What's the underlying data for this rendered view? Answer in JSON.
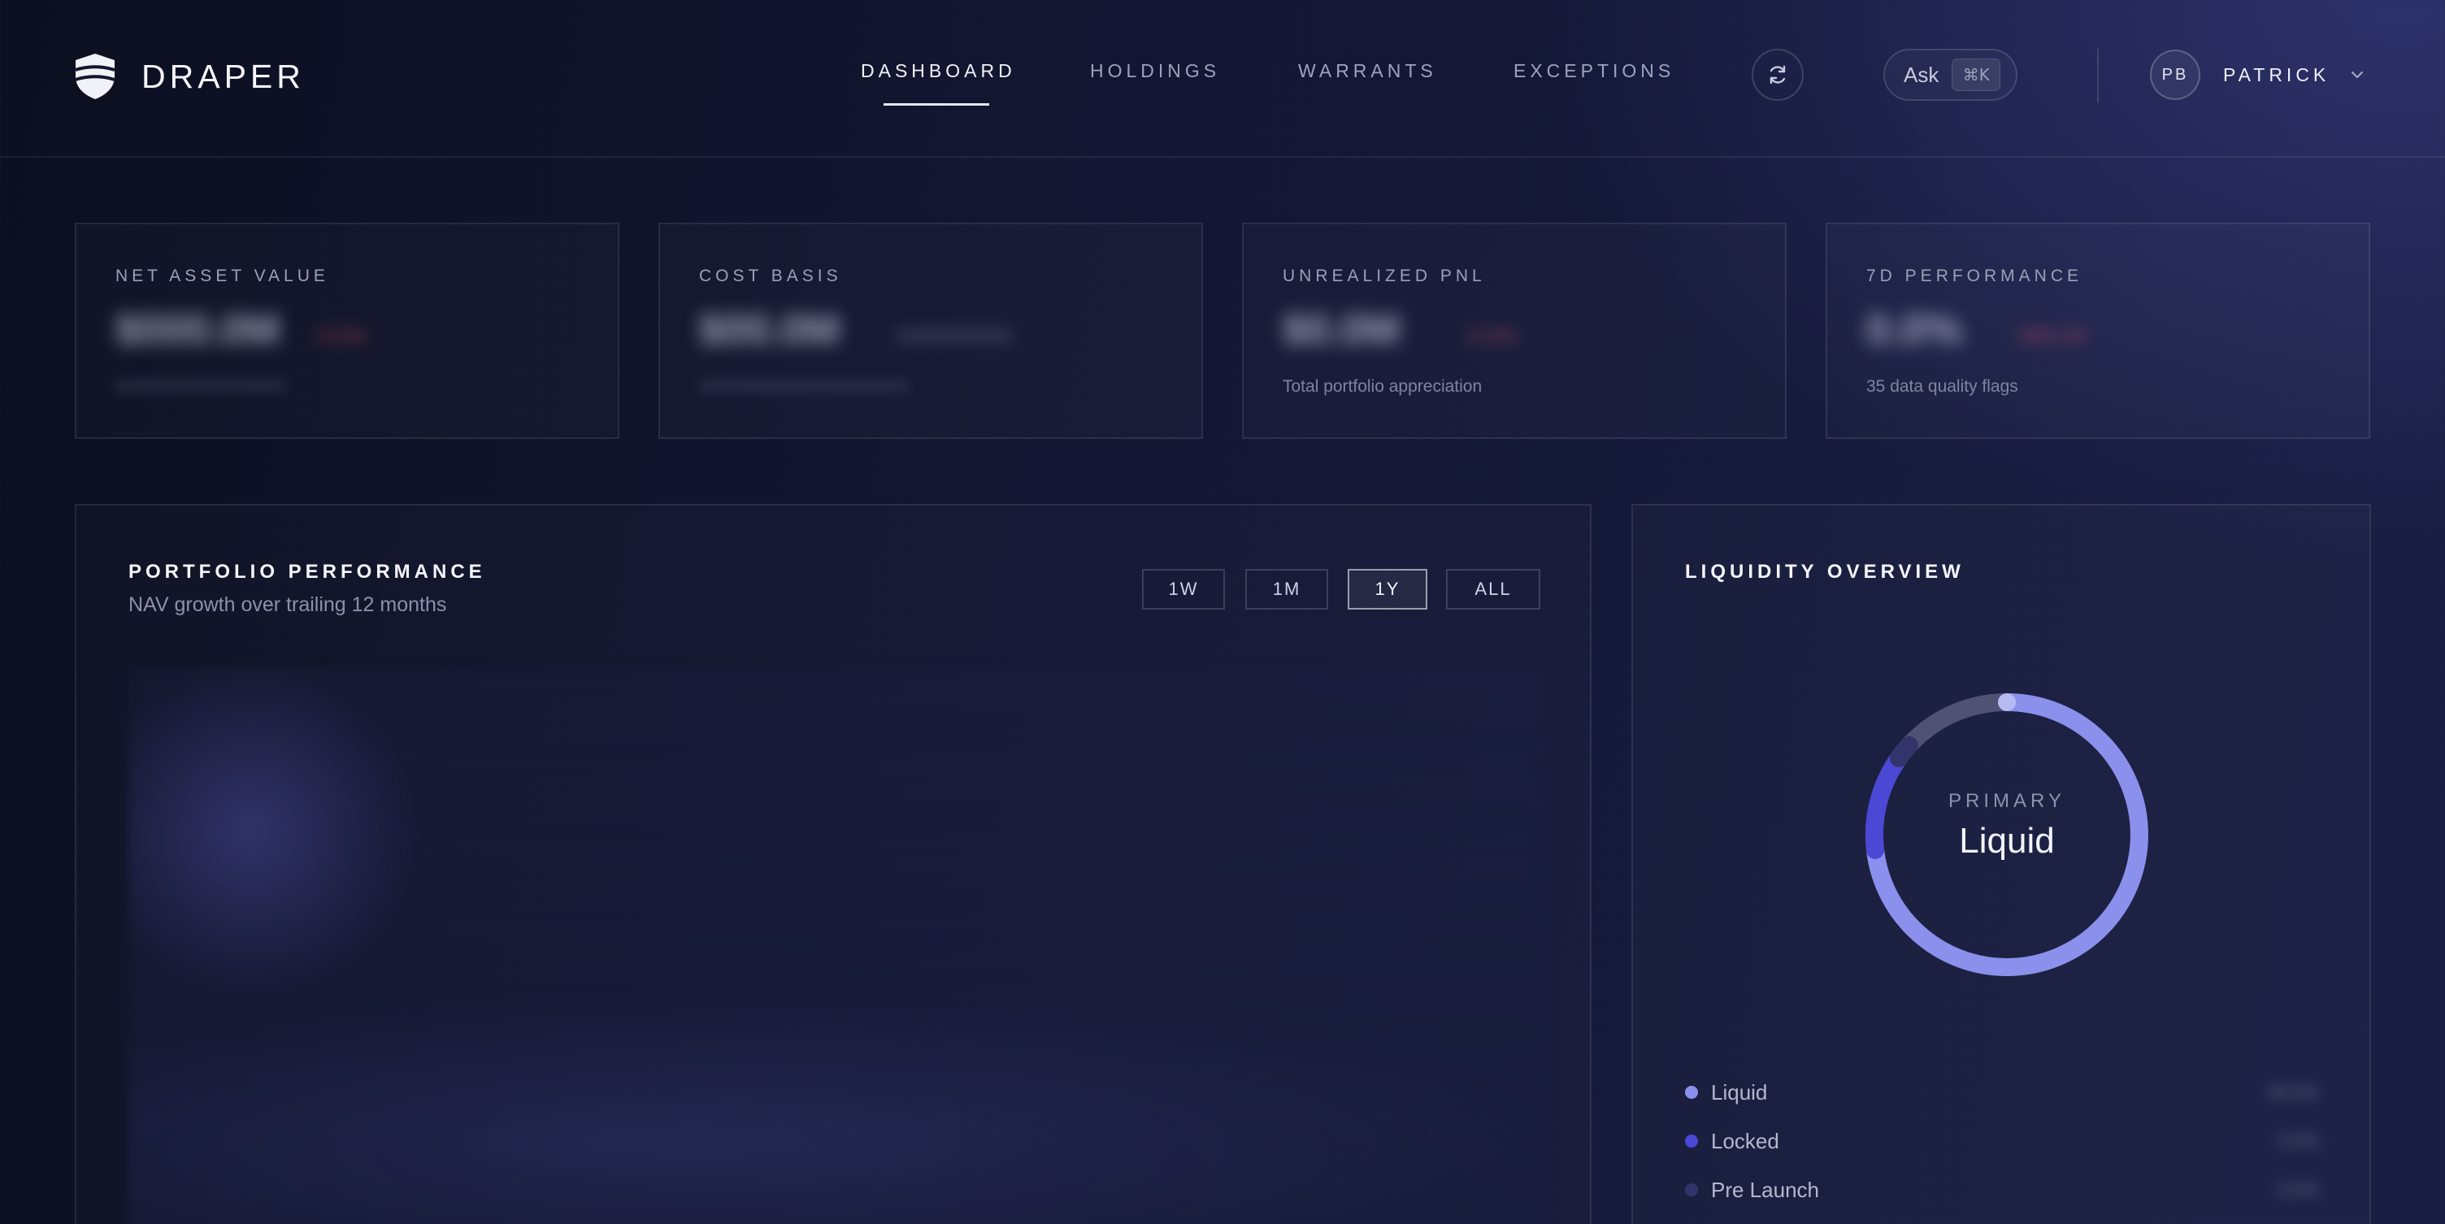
{
  "app": {
    "brand": "DRAPER"
  },
  "nav": {
    "tabs": [
      {
        "label": "DASHBOARD",
        "active": true
      },
      {
        "label": "HOLDINGS"
      },
      {
        "label": "WARRANTS"
      },
      {
        "label": "EXCEPTIONS"
      }
    ],
    "refresh_icon": "refresh-icon",
    "ask": {
      "label": "Ask",
      "shortcut": "⌘K"
    },
    "user": {
      "initials": "PB",
      "name": "PATRICK"
    }
  },
  "stats": [
    {
      "label": "NET ASSET VALUE",
      "value": "",
      "subtitle": ""
    },
    {
      "label": "COST BASIS",
      "value": "",
      "subtitle": ""
    },
    {
      "label": "UNREALIZED PNL",
      "value": "",
      "subtitle": "Total portfolio appreciation"
    },
    {
      "label": "7D PERFORMANCE",
      "value": "",
      "subtitle": "35 data quality flags"
    }
  ],
  "performance": {
    "title": "PORTFOLIO PERFORMANCE",
    "subtitle": "NAV growth over trailing 12 months",
    "ranges": [
      "1W",
      "1M",
      "1Y",
      "ALL"
    ],
    "active_range": "1Y"
  },
  "liquidity": {
    "title": "LIQUIDITY OVERVIEW",
    "primary_caption": "PRIMARY",
    "primary_value": "Liquid",
    "legend": [
      {
        "label": "Liquid",
        "color": "#8b90ec"
      },
      {
        "label": "Locked",
        "color": "#4b48d6"
      },
      {
        "label": "Pre Launch",
        "color": "#34346c"
      }
    ]
  },
  "colors": {
    "accent": "#8b90ec",
    "negative": "#b24a5d",
    "muted_ring": "#4f5273"
  }
}
